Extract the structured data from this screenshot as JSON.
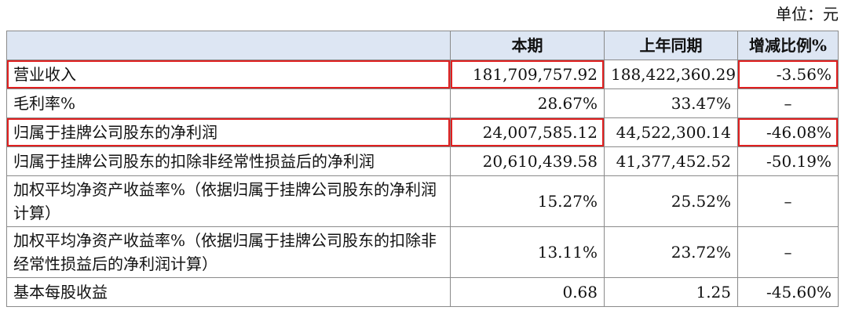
{
  "unit_label": "单位：元",
  "table": {
    "headers": [
      "",
      "本期",
      "上年同期",
      "增减比例%"
    ],
    "rows": [
      {
        "label": "营业收入",
        "current": "181,709,757.92",
        "previous": "188,422,360.29",
        "change": "-3.56%"
      },
      {
        "label": "毛利率%",
        "current": "28.67%",
        "previous": "33.47%",
        "change": "–"
      },
      {
        "label": "归属于挂牌公司股东的净利润",
        "current": "24,007,585.12",
        "previous": "44,522,300.14",
        "change": "-46.08%"
      },
      {
        "label": "归属于挂牌公司股东的扣除非经常性损益后的净利润",
        "current": "20,610,439.58",
        "previous": "41,377,452.52",
        "change": "-50.19%"
      },
      {
        "label": "加权平均净资产收益率%（依据归属于挂牌公司股东的净利润计算）",
        "current": "15.27%",
        "previous": "25.52%",
        "change": "–"
      },
      {
        "label": "加权平均净资产收益率%（依据归属于挂牌公司股东的扣除非经常性损益后的净利润计算）",
        "current": "13.11%",
        "previous": "23.72%",
        "change": "–"
      },
      {
        "label": "基本每股收益",
        "current": "0.68",
        "previous": "1.25",
        "change": "-45.60%"
      }
    ]
  },
  "highlight_color": "#e02020"
}
